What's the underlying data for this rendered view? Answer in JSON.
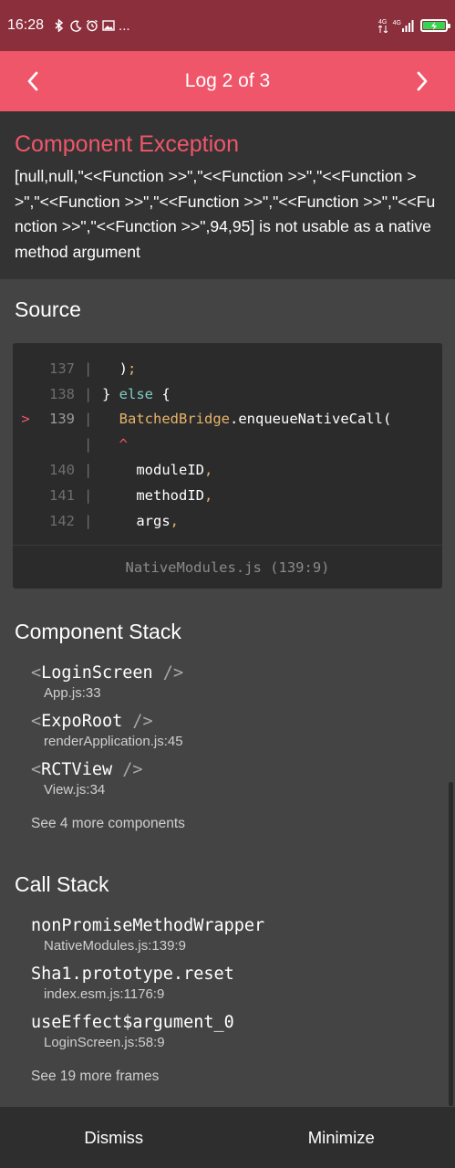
{
  "status_bar": {
    "time": "16:28",
    "more": "...",
    "icons": [
      "bluetooth-icon",
      "moon-icon",
      "alarm-icon",
      "image-icon"
    ],
    "network_label_1": "4G",
    "network_label_2": "4G",
    "battery_color": "#39d353"
  },
  "header": {
    "title": "Log 2 of 3",
    "prev_icon": "chevron-left-icon",
    "next_icon": "chevron-right-icon",
    "color": "#f0566a"
  },
  "exception": {
    "title": "Component Exception",
    "message": "[null,null,\"<<Function >>\",\"<<Function >>\",\"<<Function >>\",\"<<Function >>\",\"<<Function >>\",\"<<Function >>\",\"<<Function >>\",\"<<Function >>\",94,95] is not usable as a native method argument"
  },
  "source": {
    "title": "Source",
    "lines": [
      {
        "marker": "",
        "num": "137",
        "bar": "|",
        "code": "  );"
      },
      {
        "marker": "",
        "num": "138",
        "bar": "|",
        "code": "} else {"
      },
      {
        "marker": ">",
        "num": "139",
        "bar": "|",
        "code": "  BatchedBridge.enqueueNativeCall("
      },
      {
        "marker": "",
        "num": "",
        "bar": "|",
        "code": "  ^"
      },
      {
        "marker": "",
        "num": "140",
        "bar": "|",
        "code": "    moduleID,"
      },
      {
        "marker": "",
        "num": "141",
        "bar": "|",
        "code": "    methodID,"
      },
      {
        "marker": "",
        "num": "142",
        "bar": "|",
        "code": "    args,"
      }
    ],
    "file": "NativeModules.js (139:9)"
  },
  "component_stack": {
    "title": "Component Stack",
    "items": [
      {
        "open": "<",
        "name": "LoginScreen",
        "close": " />",
        "location": "App.js:33"
      },
      {
        "open": "<",
        "name": "ExpoRoot",
        "close": " />",
        "location": "renderApplication.js:45"
      },
      {
        "open": "<",
        "name": "RCTView",
        "close": " />",
        "location": "View.js:34"
      }
    ],
    "see_more": "See 4 more components"
  },
  "call_stack": {
    "title": "Call Stack",
    "items": [
      {
        "name": "nonPromiseMethodWrapper",
        "location": "NativeModules.js:139:9"
      },
      {
        "name": "Sha1.prototype.reset",
        "location": "index.esm.js:1176:9"
      },
      {
        "name": "useEffect$argument_0",
        "location": "LoginScreen.js:58:9"
      }
    ],
    "see_more": "See 19 more frames"
  },
  "footer": {
    "dismiss": "Dismiss",
    "minimize": "Minimize"
  }
}
